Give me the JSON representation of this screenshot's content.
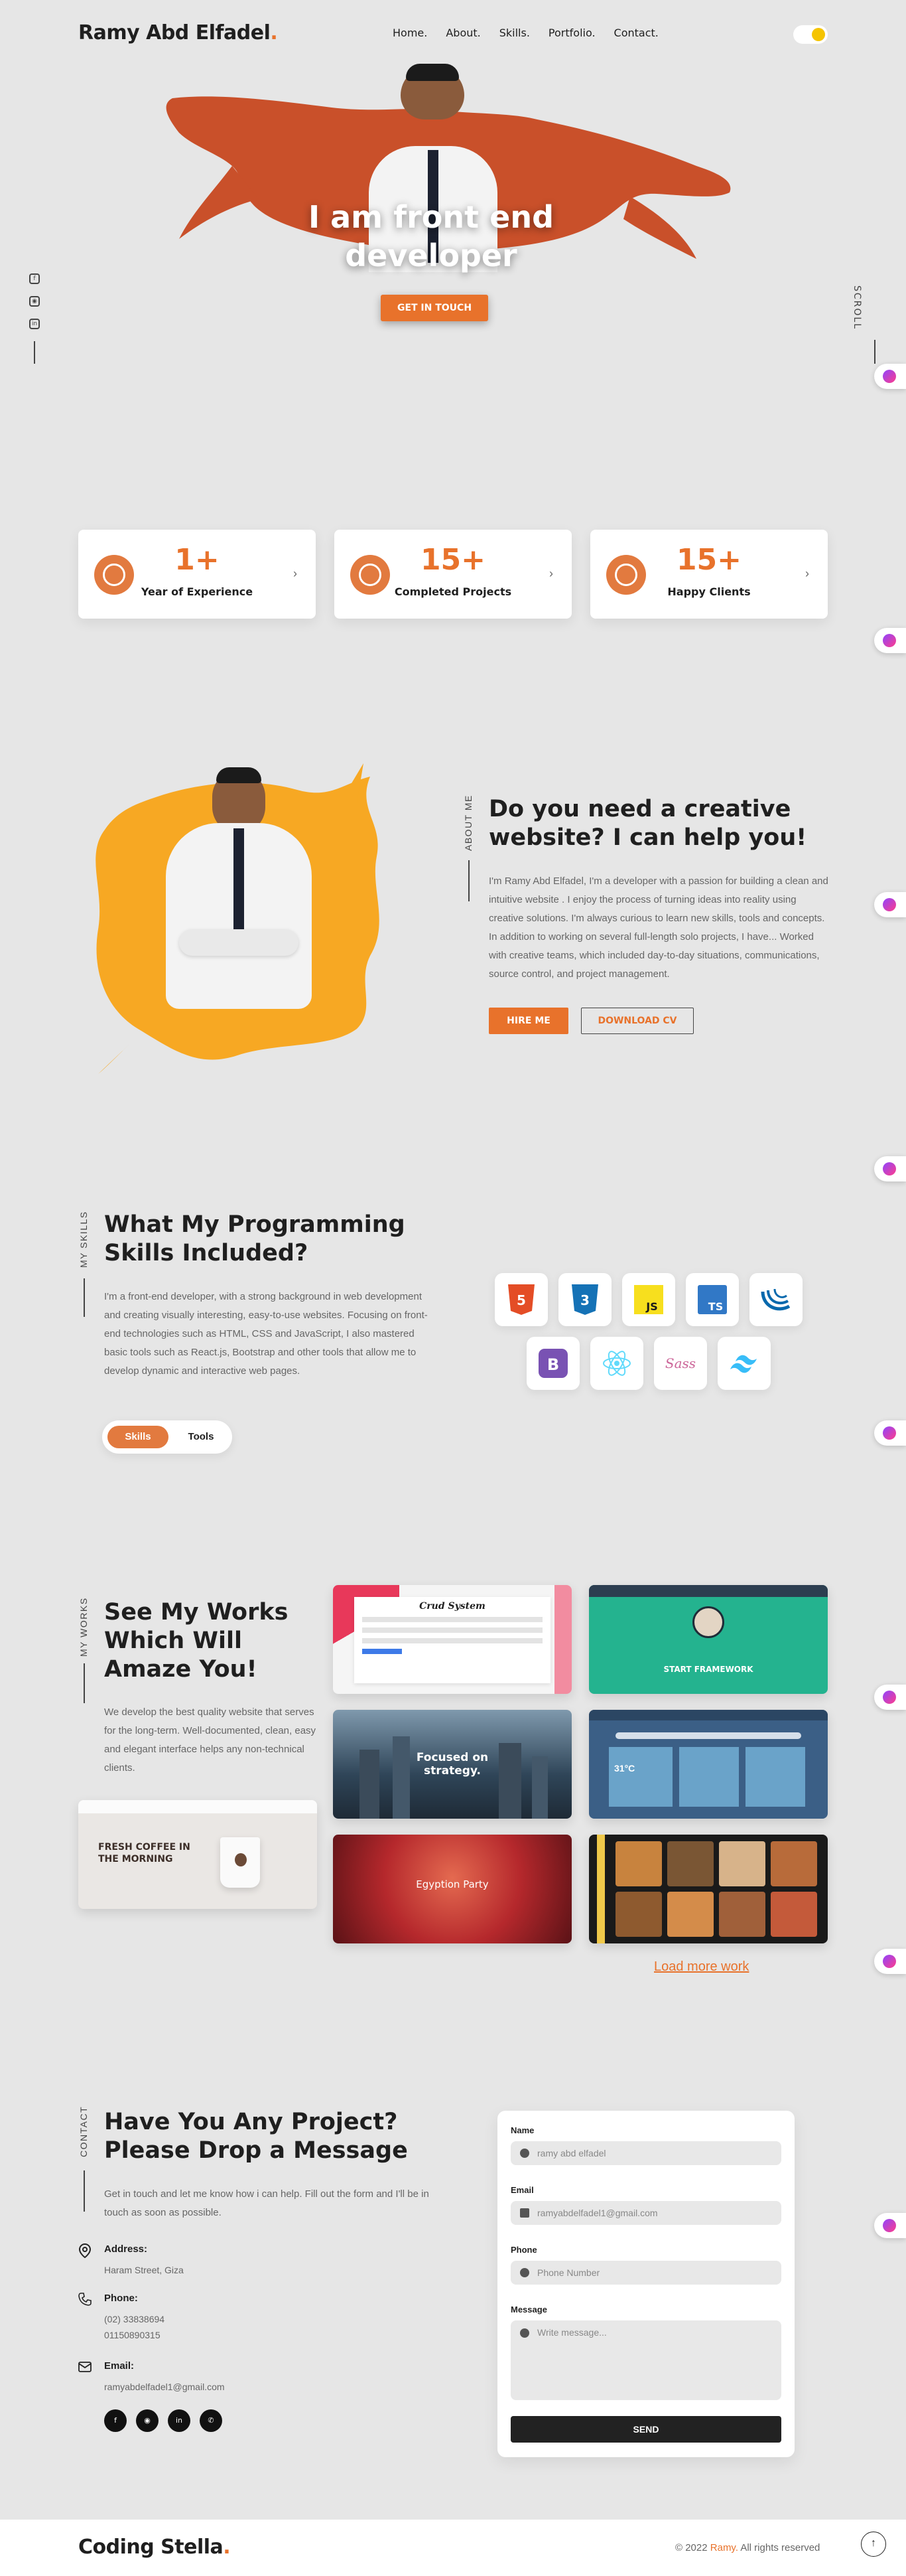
{
  "header": {
    "logo": "Ramy Abd Elfadel",
    "logo_dot": ".",
    "nav": [
      "Home.",
      "About.",
      "Skills.",
      "Portfolio.",
      "Contact."
    ],
    "theme_toggle": "sun-icon"
  },
  "side": {
    "icons": [
      "facebook-icon",
      "github-icon",
      "linkedin-icon"
    ],
    "scroll_label": "SCROLL"
  },
  "hero": {
    "title_line1": "I am front end",
    "title_line2": "developer",
    "cta": "GET IN TOUCH",
    "splash_color": "#c9502a"
  },
  "stats": [
    {
      "number": "1+",
      "label": "Year of Experience",
      "icon": "award-icon"
    },
    {
      "number": "15+",
      "label": "Completed Projects",
      "icon": "check-circle-icon"
    },
    {
      "number": "15+",
      "label": "Happy Clients",
      "icon": "users-icon"
    }
  ],
  "about": {
    "tag": "ABOUT ME",
    "title_line1": "Do you need a creative",
    "title_line2": "website? I can help you!",
    "text": "I'm Ramy Abd Elfadel, I'm a developer with a passion for building a clean and intuitive website . I enjoy the process of turning ideas into reality using creative solutions. I'm always curious to learn new skills, tools and concepts. In addition to working on several full-length solo projects, I have... Worked with creative teams, which included day-to-day situations, communications, source control, and project management.",
    "hire": "HIRE ME",
    "cv": "DOWNLOAD CV",
    "splash_color": "#f7a823"
  },
  "skills": {
    "tag": "MY SKILLS",
    "title_line1": "What My Programming",
    "title_line2": "Skills Included?",
    "text": "I'm a front-end developer, with a strong background in web development and creating visually interesting, easy-to-use websites. Focusing on front-end technologies such as HTML, CSS and JavaScript, I also mastered basic tools such as React.js, Bootstrap and other tools that allow me to develop dynamic and interactive web pages.",
    "tab_active": "Skills",
    "tab_other": "Tools",
    "icons": [
      {
        "name": "html5-icon",
        "text": "5",
        "color": "#e44d26"
      },
      {
        "name": "css3-icon",
        "text": "3",
        "color": "#1572b6"
      },
      {
        "name": "javascript-icon",
        "text": "JS",
        "color": "#f7df1e"
      },
      {
        "name": "typescript-icon",
        "text": "TS",
        "color": "#3178c6"
      },
      {
        "name": "jquery-icon",
        "text": "",
        "color": "#0769ad"
      },
      {
        "name": "bootstrap-icon",
        "text": "B",
        "color": "#7952b3"
      },
      {
        "name": "react-icon",
        "text": "",
        "color": "#61dafb"
      },
      {
        "name": "sass-icon",
        "text": "Sass",
        "color": "#cc6699"
      },
      {
        "name": "tailwind-icon",
        "text": "",
        "color": "#38bdf8"
      }
    ]
  },
  "works": {
    "tag": "MY WORKS",
    "title_line1": "See My Works",
    "title_line2": "Which Will",
    "title_line3": "Amaze You!",
    "text": "We develop the best quality website that serves for the long-term. Well-documented, clean, easy and elegant interface helps any non-technical clients.",
    "items": [
      {
        "label": "Crud System"
      },
      {
        "label": "START FRAMEWORK"
      },
      {
        "label": "Focused on strategy."
      },
      {
        "label": "31°C"
      },
      {
        "label": "FRESH COFFEE IN THE MORNING"
      },
      {
        "label": "Egyption Party"
      },
      {
        "label": ""
      }
    ],
    "load_more": "Load more work"
  },
  "contact": {
    "tag": "CONTACT",
    "title_line1": "Have You Any Project?",
    "title_line2": "Please Drop a Message",
    "text": "Get in touch and let me know how i can help. Fill out the form and I'll be in touch as soon as possible.",
    "address_label": "Address:",
    "address": "Haram Street, Giza",
    "phone_label": "Phone:",
    "phone1": "(02) 33838694",
    "phone2": "01150890315",
    "email_label": "Email:",
    "email": "ramyabdelfadel1@gmail.com",
    "socials": [
      "facebook-icon",
      "github-icon",
      "linkedin-icon",
      "whatsapp-icon"
    ],
    "form": {
      "name_label": "Name",
      "name_placeholder": "ramy abd elfadel",
      "email_label": "Email",
      "email_placeholder": "ramyabdelfadel1@gmail.com",
      "phone_label": "Phone",
      "phone_placeholder": "Phone Number",
      "message_label": "Message",
      "message_placeholder": "Write message...",
      "send": "SEND"
    }
  },
  "footer": {
    "logo": "Coding Stella",
    "logo_dot": ".",
    "copy_prefix": "© 2022",
    "copy_name": "Ramy.",
    "copy_suffix": "All rights reserved"
  },
  "colors": {
    "accent": "#e8722b",
    "background": "#e6e6e6"
  }
}
